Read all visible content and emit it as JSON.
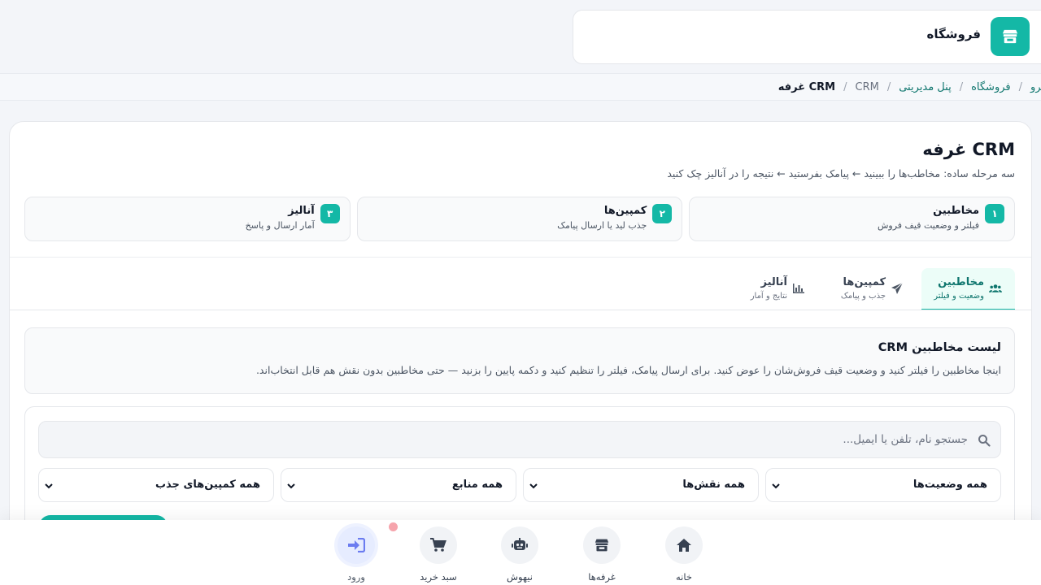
{
  "shop": {
    "name": "فروشگاه",
    "icon": "store-icon"
  },
  "breadcrumb": {
    "items": [
      {
        "label": "نیرو"
      },
      {
        "label": "فروشگاه"
      },
      {
        "label": "پنل مدیریتی"
      },
      {
        "label": "CRM"
      },
      {
        "label": "CRM غرفه"
      }
    ],
    "separator": "/"
  },
  "page": {
    "title": "CRM غرفه",
    "subtitle": "سه مرحله ساده: مخاطب‌ها را ببینید ← پیامک بفرستید ← نتیجه را در آنالیز چک کنید"
  },
  "steps": [
    {
      "num": "۱",
      "title": "مخاطبین",
      "desc": "فیلتر و وضعیت قیف فروش"
    },
    {
      "num": "۲",
      "title": "کمپین‌ها",
      "desc": "جذب لید یا ارسال پیامک"
    },
    {
      "num": "۳",
      "title": "آنالیز",
      "desc": "آمار ارسال و پاسخ"
    }
  ],
  "tabs": [
    {
      "title": "مخاطبین",
      "desc": "وضعیت و فیلتر",
      "icon": "users-icon",
      "active": true
    },
    {
      "title": "کمپین‌ها",
      "desc": "جذب و پیامک",
      "icon": "paper-plane-icon",
      "active": false
    },
    {
      "title": "آنالیز",
      "desc": "نتایج و آمار",
      "icon": "bar-chart-icon",
      "active": false
    }
  ],
  "info": {
    "title": "لیست مخاطبین CRM",
    "text": "اینجا مخاطبین را فیلتر کنید و وضعیت قیف فروش‌شان را عوض کنید. برای ارسال پیامک، فیلتر را تنظیم کنید و دکمه پایین را بزنید — حتی مخاطبین بدون نقش هم قابل انتخاب‌اند."
  },
  "search": {
    "placeholder": "جستجو نام، تلفن یا ایمیل...",
    "value": ""
  },
  "filters": [
    {
      "value": "همه وضعیت‌ها"
    },
    {
      "value": "همه نقش‌ها"
    },
    {
      "value": "همه منابع"
    },
    {
      "value": "همه کمپین‌های جذب"
    }
  ],
  "bottom_nav": [
    {
      "label": "خانه",
      "icon": "home-icon"
    },
    {
      "label": "غرفه‌ها",
      "icon": "store-icon"
    },
    {
      "label": "نیهوش",
      "icon": "robot-icon"
    },
    {
      "label": "سبد خرید",
      "icon": "cart-icon"
    },
    {
      "label": "ورود",
      "icon": "login-icon"
    }
  ],
  "colors": {
    "accent": "#14b8a6",
    "login_accent": "#6b7cf0",
    "notification_dot": "#f6a4ac"
  }
}
